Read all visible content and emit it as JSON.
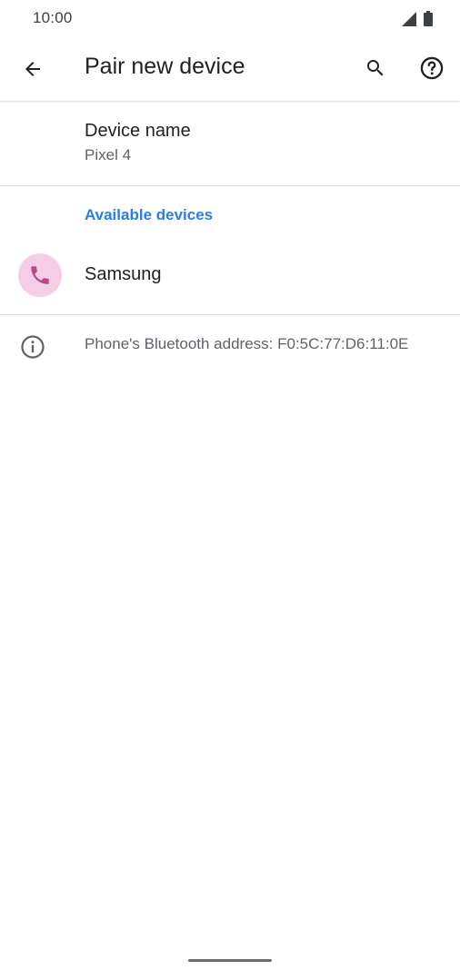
{
  "status_bar": {
    "time": "10:00",
    "icons": [
      "signal-icon",
      "battery-icon"
    ]
  },
  "app_bar": {
    "title": "Pair new device",
    "back_icon": "back-arrow-icon",
    "search_icon": "search-icon",
    "help_icon": "help-icon"
  },
  "device_name": {
    "title": "Device name",
    "value": "Pixel 4"
  },
  "available_devices": {
    "header": "Available devices",
    "items": [
      {
        "label": "Samsung",
        "icon": "phone-icon"
      }
    ]
  },
  "footer": {
    "icon": "info-icon",
    "text": "Phone's Bluetooth address: F0:5C:77:D6:11:0E"
  },
  "colors": {
    "accent": "#1a73e8",
    "device_avatar_bg": "#f5cde7",
    "device_icon": "#b64a8f",
    "text_primary": "#202124",
    "text_secondary": "#5f6368",
    "divider": "#dadce0"
  }
}
